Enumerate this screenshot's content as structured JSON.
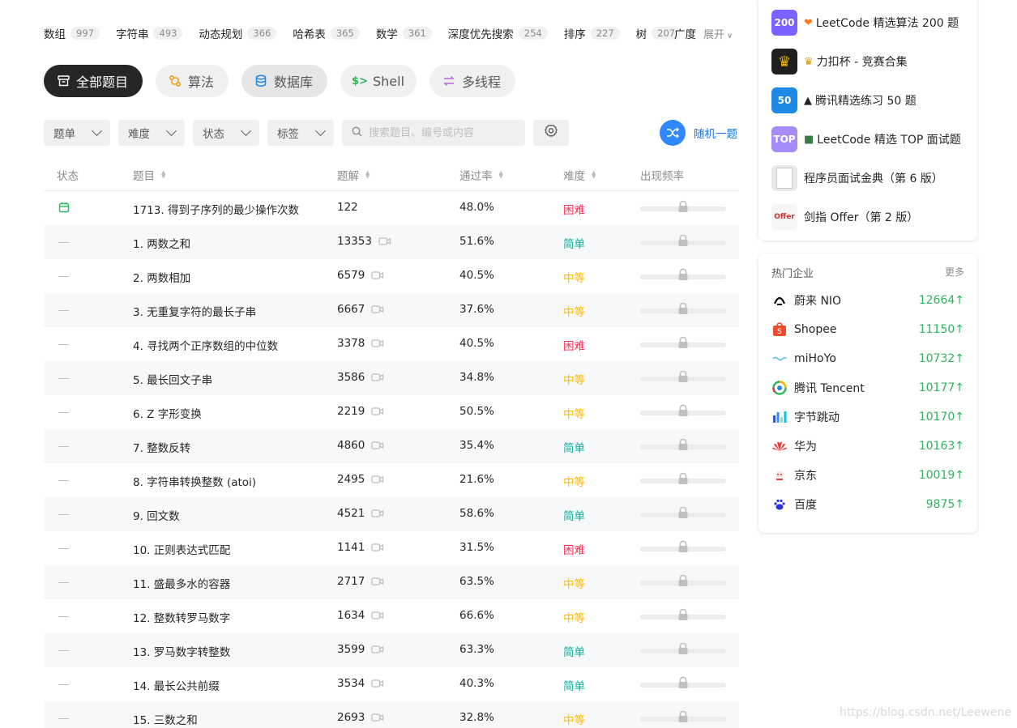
{
  "tags": [
    {
      "name": "数组",
      "count": "997"
    },
    {
      "name": "字符串",
      "count": "493"
    },
    {
      "name": "动态规划",
      "count": "366"
    },
    {
      "name": "哈希表",
      "count": "365"
    },
    {
      "name": "数学",
      "count": "361"
    },
    {
      "name": "深度优先搜索",
      "count": "254"
    },
    {
      "name": "排序",
      "count": "227"
    },
    {
      "name": "树",
      "count": "207"
    }
  ],
  "tags_partial": "广度",
  "tags_expand": "展开",
  "categories": [
    {
      "label": "全部题目",
      "icon": "inbox-icon"
    },
    {
      "label": "算法",
      "icon": "algorithm-icon"
    },
    {
      "label": "数据库",
      "icon": "database-icon"
    },
    {
      "label": "Shell",
      "icon": "shell-icon"
    },
    {
      "label": "多线程",
      "icon": "concurrency-icon"
    }
  ],
  "filters": {
    "list": "题单",
    "difficulty": "难度",
    "status": "状态",
    "tags": "标签",
    "search_placeholder": "搜索题目、编号或内容",
    "random": "随机一题"
  },
  "table": {
    "headers": {
      "status": "状态",
      "title": "题目",
      "solutions": "题解",
      "acceptance": "通过率",
      "difficulty": "难度",
      "frequency": "出现频率"
    },
    "rows": [
      {
        "status": "daily",
        "title": "1713. 得到子序列的最少操作次数",
        "solutions": "122",
        "video": false,
        "acceptance": "48.0%",
        "difficulty": "困难",
        "level": "hard"
      },
      {
        "status": "none",
        "title": "1. 两数之和",
        "solutions": "13353",
        "video": true,
        "acceptance": "51.6%",
        "difficulty": "简单",
        "level": "easy"
      },
      {
        "status": "none",
        "title": "2. 两数相加",
        "solutions": "6579",
        "video": true,
        "acceptance": "40.5%",
        "difficulty": "中等",
        "level": "medium"
      },
      {
        "status": "none",
        "title": "3. 无重复字符的最长子串",
        "solutions": "6667",
        "video": true,
        "acceptance": "37.6%",
        "difficulty": "中等",
        "level": "medium"
      },
      {
        "status": "none",
        "title": "4. 寻找两个正序数组的中位数",
        "solutions": "3378",
        "video": true,
        "acceptance": "40.5%",
        "difficulty": "困难",
        "level": "hard"
      },
      {
        "status": "none",
        "title": "5. 最长回文子串",
        "solutions": "3586",
        "video": true,
        "acceptance": "34.8%",
        "difficulty": "中等",
        "level": "medium"
      },
      {
        "status": "none",
        "title": "6. Z 字形变换",
        "solutions": "2219",
        "video": true,
        "acceptance": "50.5%",
        "difficulty": "中等",
        "level": "medium"
      },
      {
        "status": "none",
        "title": "7. 整数反转",
        "solutions": "4860",
        "video": true,
        "acceptance": "35.4%",
        "difficulty": "简单",
        "level": "easy"
      },
      {
        "status": "none",
        "title": "8. 字符串转换整数 (atoi)",
        "solutions": "2495",
        "video": true,
        "acceptance": "21.6%",
        "difficulty": "中等",
        "level": "medium"
      },
      {
        "status": "none",
        "title": "9. 回文数",
        "solutions": "4521",
        "video": true,
        "acceptance": "58.6%",
        "difficulty": "简单",
        "level": "easy"
      },
      {
        "status": "none",
        "title": "10. 正则表达式匹配",
        "solutions": "1141",
        "video": true,
        "acceptance": "31.5%",
        "difficulty": "困难",
        "level": "hard"
      },
      {
        "status": "none",
        "title": "11. 盛最多水的容器",
        "solutions": "2717",
        "video": true,
        "acceptance": "63.5%",
        "difficulty": "中等",
        "level": "medium"
      },
      {
        "status": "none",
        "title": "12. 整数转罗马数字",
        "solutions": "1634",
        "video": true,
        "acceptance": "66.6%",
        "difficulty": "中等",
        "level": "medium"
      },
      {
        "status": "none",
        "title": "13. 罗马数字转整数",
        "solutions": "3599",
        "video": true,
        "acceptance": "63.3%",
        "difficulty": "简单",
        "level": "easy"
      },
      {
        "status": "none",
        "title": "14. 最长公共前缀",
        "solutions": "3534",
        "video": true,
        "acceptance": "40.3%",
        "difficulty": "简单",
        "level": "easy"
      },
      {
        "status": "none",
        "title": "15. 三数之和",
        "solutions": "2693",
        "video": true,
        "acceptance": "32.8%",
        "difficulty": "中等",
        "level": "medium"
      }
    ]
  },
  "study_plans": [
    {
      "cover": "200",
      "cover_color": "#7b61ff",
      "emoji": "heart-icon",
      "title": "LeetCode 精选算法 200 题"
    },
    {
      "cover": "trophy",
      "cover_color": "#1f1f1f",
      "emoji": "trophy-icon",
      "title": "力扣杯 - 竞赛合集"
    },
    {
      "cover": "50",
      "cover_color": "#1e88e5",
      "emoji": "penguin-icon",
      "title": "腾讯精选练习 50 题"
    },
    {
      "cover": "TOP",
      "cover_color": "#a78bfa",
      "emoji": "person-icon",
      "title": "LeetCode 精选 TOP 面试题"
    },
    {
      "cover": "book",
      "cover_color": "#e8e8e8",
      "emoji": "",
      "title": "程序员面试金典（第 6 版）"
    },
    {
      "cover": "Offer",
      "cover_color": "#f5f5f5",
      "emoji": "",
      "title": "剑指 Offer（第 2 版）"
    }
  ],
  "companies": {
    "title": "热门企业",
    "more": "更多",
    "items": [
      {
        "name": "蔚来 NIO",
        "count": "12664",
        "logo": "nio-logo"
      },
      {
        "name": "Shopee",
        "count": "11150",
        "logo": "shopee-logo"
      },
      {
        "name": "miHoYo",
        "count": "10732",
        "logo": "mihoyo-logo"
      },
      {
        "name": "腾讯 Tencent",
        "count": "10177",
        "logo": "tencent-logo"
      },
      {
        "name": "字节跳动",
        "count": "10170",
        "logo": "bytedance-logo"
      },
      {
        "name": "华为",
        "count": "10163",
        "logo": "huawei-logo"
      },
      {
        "name": "京东",
        "count": "10019",
        "logo": "jd-logo"
      },
      {
        "name": "百度",
        "count": "9875",
        "logo": "baidu-logo"
      }
    ]
  },
  "watermark": "https://blog.csdn.net/Leewene"
}
